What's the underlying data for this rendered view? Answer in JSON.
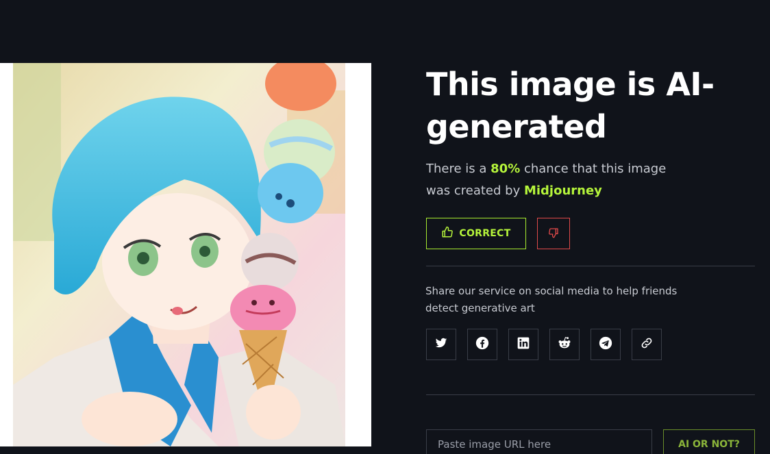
{
  "result": {
    "title": "This image is AI-generated",
    "line1_prefix": "There is a ",
    "probability": "80%",
    "line1_suffix": " chance that this image",
    "line2_prefix": "was created by ",
    "generator": "Midjourney"
  },
  "feedback": {
    "correct_label": "CORRECT",
    "correct_icon": "thumbs-up-icon",
    "wrong_icon": "thumbs-down-icon"
  },
  "share": {
    "text": "Share our service on social media to help friends detect generative art",
    "buttons": [
      {
        "name": "twitter",
        "icon": "twitter-icon"
      },
      {
        "name": "facebook",
        "icon": "facebook-icon"
      },
      {
        "name": "linkedin",
        "icon": "linkedin-icon"
      },
      {
        "name": "reddit",
        "icon": "reddit-icon"
      },
      {
        "name": "telegram",
        "icon": "telegram-icon"
      },
      {
        "name": "copy-link",
        "icon": "link-icon"
      }
    ]
  },
  "check": {
    "placeholder": "Paste image URL here",
    "button_label": "AI OR NOT?"
  },
  "colors": {
    "background": "#10131a",
    "accent": "#b6f53b",
    "danger": "#e24a4a",
    "border": "#3a3e48",
    "text_muted": "#c9ccd3"
  }
}
